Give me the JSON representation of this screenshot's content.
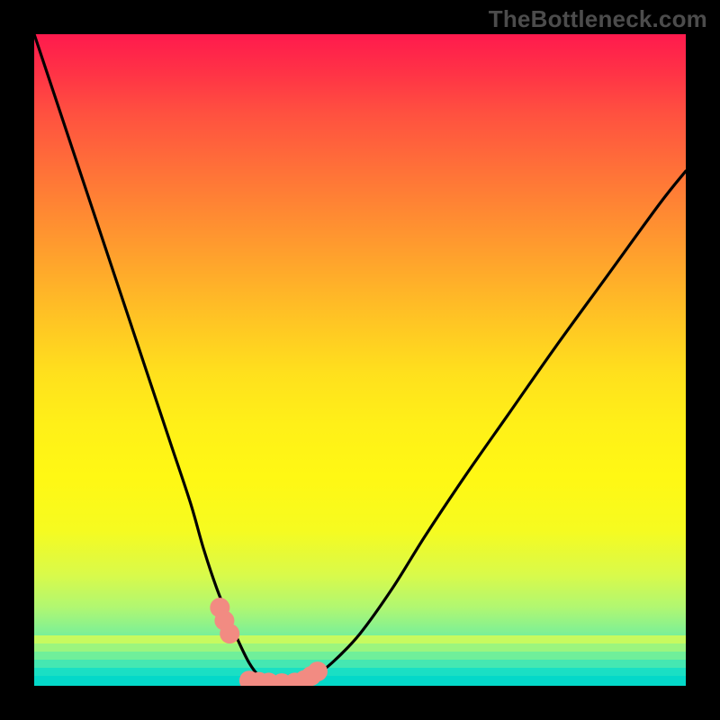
{
  "watermark": "TheBottleneck.com",
  "colors": {
    "frame": "#000000",
    "curve": "#000000",
    "dot_fill": "#f28b82",
    "dot_stroke": "#f28b82"
  },
  "chart_data": {
    "type": "line",
    "title": "",
    "xlabel": "",
    "ylabel": "",
    "xlim": [
      0,
      100
    ],
    "ylim": [
      0,
      100
    ],
    "annotations": [
      "TheBottleneck.com"
    ],
    "series": [
      {
        "name": "bottleneck-curve",
        "x": [
          0,
          3,
          6,
          9,
          12,
          15,
          18,
          21,
          24,
          26,
          28,
          30,
          31.5,
          33,
          34.5,
          36,
          38,
          40,
          43,
          46,
          50,
          55,
          60,
          66,
          73,
          80,
          88,
          96,
          100
        ],
        "y": [
          100,
          91,
          82,
          73,
          64,
          55,
          46,
          37,
          28,
          21,
          15,
          10,
          6.5,
          3.5,
          1.5,
          0.5,
          0.3,
          0.5,
          1.5,
          3.8,
          8,
          15,
          23,
          32,
          42,
          52,
          63,
          74,
          79
        ]
      }
    ],
    "scatter_points": {
      "name": "highlighted-points",
      "x": [
        28.5,
        29.2,
        30.0,
        33.0,
        34.5,
        36.0,
        38.0,
        40.0,
        41.5,
        42.5,
        43.5
      ],
      "y": [
        12.0,
        10.0,
        8.0,
        0.8,
        0.6,
        0.5,
        0.4,
        0.5,
        0.9,
        1.5,
        2.2
      ]
    },
    "gradient_stops": [
      {
        "pos": 0,
        "color": "#ff1a4d"
      },
      {
        "pos": 50,
        "color": "#ffe01d"
      },
      {
        "pos": 100,
        "color": "#02d6ca"
      }
    ]
  }
}
